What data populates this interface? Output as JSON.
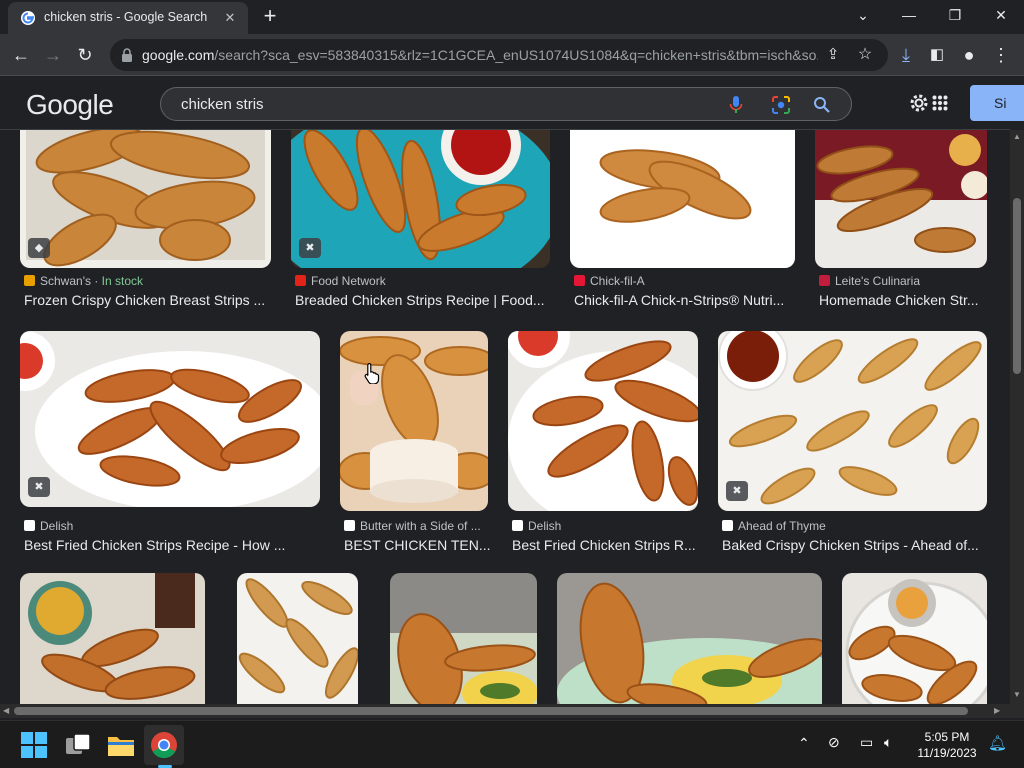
{
  "browser": {
    "tab_title": "chicken stris - Google Search",
    "new_tab": "+",
    "url_host": "google.com",
    "url_rest": "/search?sca_esv=583840315&rlz=1C1GCEA_enUS1074US1084&q=chicken+stris&tbm=isch&so..."
  },
  "google": {
    "logo": "Google",
    "query": "chicken stris",
    "signin_label": "Si"
  },
  "results": [
    {
      "source": "Schwan's",
      "in_stock": "In stock",
      "title": "Frozen Crispy Chicken Breast Strips ...",
      "badge": "tag"
    },
    {
      "source": "Food Network",
      "title": "Breaded Chicken Strips Recipe | Food...",
      "badge": "recipe"
    },
    {
      "source": "Chick-fil-A",
      "title": "Chick-fil-A Chick-n-Strips® Nutri..."
    },
    {
      "source": "Leite's Culinaria",
      "title": "Homemade Chicken Str..."
    },
    {
      "source": "Delish",
      "title": "Best Fried Chicken Strips Recipe - How ...",
      "badge": "recipe"
    },
    {
      "source": "Butter with a Side of ...",
      "title": "BEST CHICKEN TEN..."
    },
    {
      "source": "Delish",
      "title": "Best Fried Chicken Strips R..."
    },
    {
      "source": "Ahead of Thyme",
      "title": "Baked Crispy Chicken Strips - Ahead of...",
      "badge": "recipe"
    }
  ],
  "colors": {
    "page_bg": "#202124",
    "accent": "#8ab4f8",
    "stock_green": "#81c995",
    "chicken": "#c9853a",
    "chicken_dark": "#a2601f"
  },
  "taskbar": {
    "apps": [
      "windows-start",
      "task-view",
      "file-explorer",
      "chrome"
    ],
    "time": "5:05 PM",
    "date": "11/19/2023"
  }
}
